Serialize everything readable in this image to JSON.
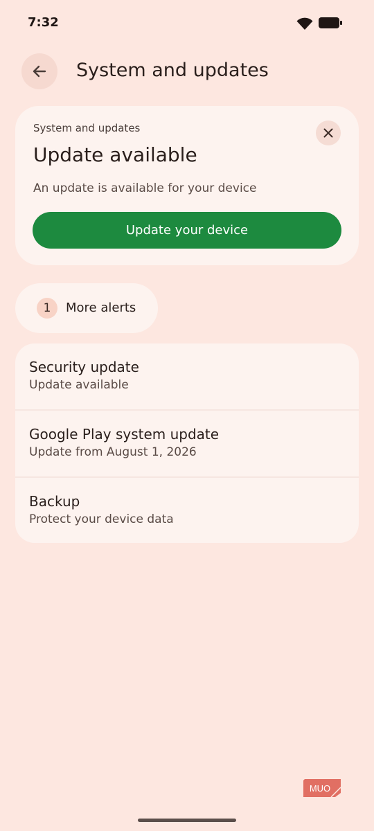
{
  "status_bar": {
    "time": "7:32",
    "icons": [
      "wifi-icon",
      "battery-icon"
    ]
  },
  "header": {
    "back_icon": "arrow-left-icon",
    "title": "System and updates"
  },
  "update_card": {
    "subtitle": "System and updates",
    "title": "Update available",
    "description": "An update is available for your device",
    "button_label": "Update your device",
    "close_icon": "close-icon"
  },
  "alerts": {
    "count": "1",
    "label": "More alerts"
  },
  "list": {
    "items": [
      {
        "title": "Security update",
        "subtitle": "Update available"
      },
      {
        "title": "Google Play system update",
        "subtitle": "Update from August 1, 2026"
      },
      {
        "title": "Backup",
        "subtitle": "Protect your device data"
      }
    ]
  },
  "watermark": {
    "text": "MUO"
  },
  "colors": {
    "background": "#fde7e0",
    "card": "#fdf3ef",
    "primary_button": "#1d8a3f",
    "text": "#2a1f1c"
  }
}
